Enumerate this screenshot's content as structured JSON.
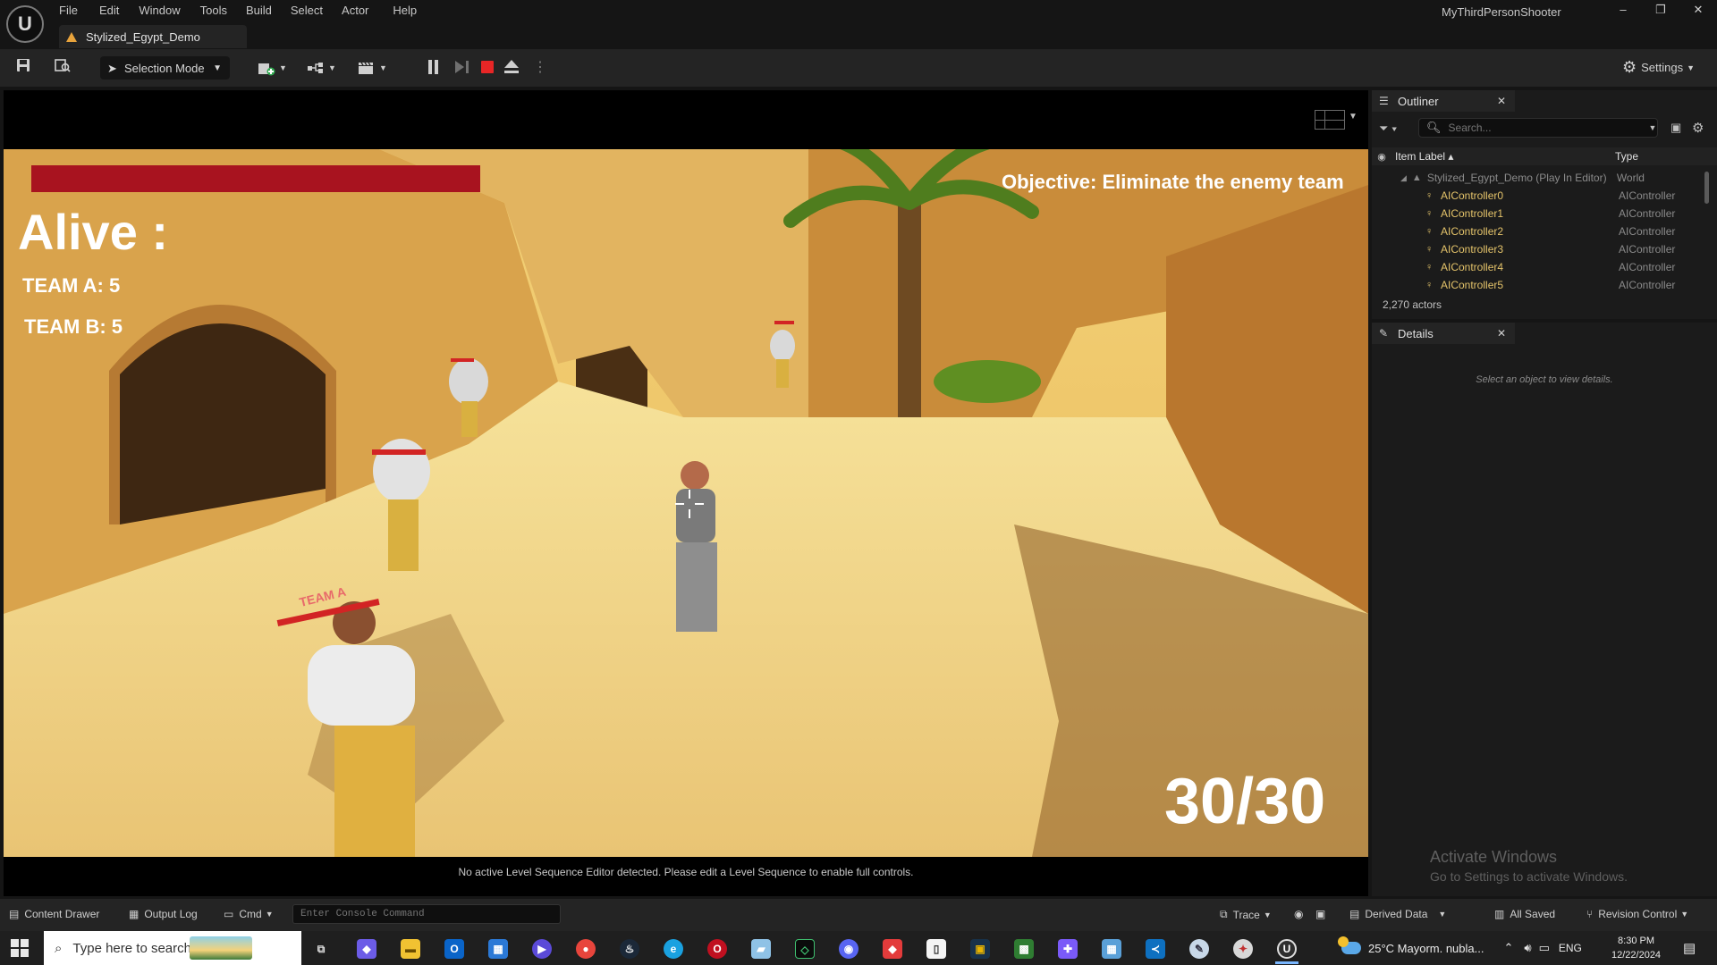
{
  "app": {
    "project_name": "MyThirdPersonShooter",
    "level_tab": "Stylized_Egypt_Demo",
    "logo_icon": "unreal-engine-logo",
    "menu": [
      "File",
      "Edit",
      "Window",
      "Tools",
      "Build",
      "Select",
      "Actor",
      "Help"
    ],
    "window_controls": [
      "–",
      "❐",
      "✕"
    ]
  },
  "toolbar": {
    "selection_mode": "Selection Mode",
    "settings": "Settings",
    "play_state": "playing"
  },
  "viewport": {
    "hud": {
      "alive_label": "Alive :",
      "team_a": "TEAM A: 5",
      "team_b": "TEAM B: 5",
      "objective": "Objective: Eliminate the enemy team",
      "ammo": "30/30",
      "health_color": "#a8131f",
      "enemy_label": "TEAM A"
    },
    "sequence_message": "No active Level Sequence Editor detected. Please edit a Level Sequence to enable full controls."
  },
  "outliner": {
    "tab_title": "Outliner",
    "search_placeholder": "Search...",
    "columns": {
      "label": "Item Label",
      "type": "Type"
    },
    "world_row": {
      "label": "Stylized_Egypt_Demo (Play In Editor)",
      "type": "World"
    },
    "rows": [
      {
        "label": "AIController0",
        "type": "AIController"
      },
      {
        "label": "AIController1",
        "type": "AIController"
      },
      {
        "label": "AIController2",
        "type": "AIController"
      },
      {
        "label": "AIController3",
        "type": "AIController"
      },
      {
        "label": "AIController4",
        "type": "AIController"
      },
      {
        "label": "AIController5",
        "type": "AIController"
      }
    ],
    "actor_count": "2,270 actors"
  },
  "details": {
    "tab_title": "Details",
    "empty_message": "Select an object to view details.",
    "watermark_title": "Activate Windows",
    "watermark_sub": "Go to Settings to activate Windows."
  },
  "statusbar": {
    "content_drawer": "Content Drawer",
    "output_log": "Output Log",
    "cmd": "Cmd",
    "console_placeholder": "Enter Console Command",
    "trace": "Trace",
    "derived_data": "Derived Data",
    "all_saved": "All Saved",
    "revision_control": "Revision Control"
  },
  "taskbar": {
    "search_placeholder": "Type here to search",
    "weather": "25°C  Mayorm. nubla...",
    "language": "ENG",
    "time": "8:30 PM",
    "date": "12/22/2024"
  }
}
